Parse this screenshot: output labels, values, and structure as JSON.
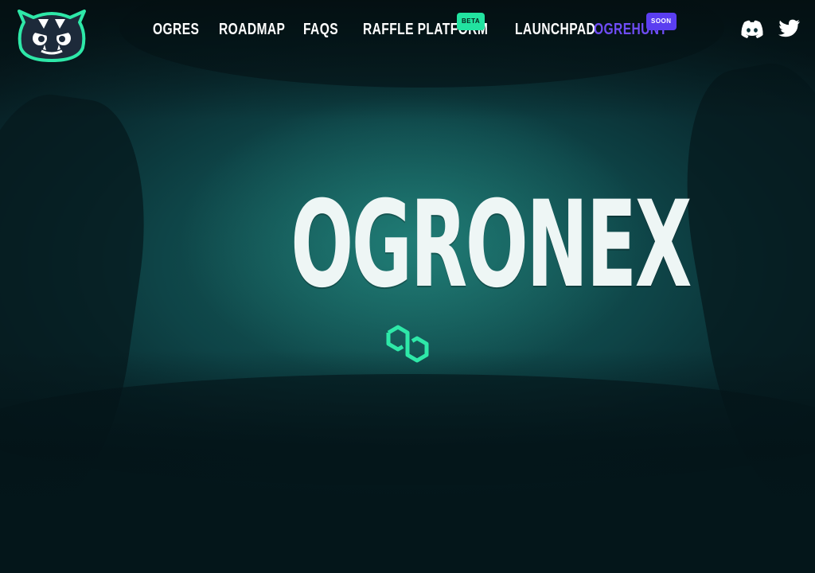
{
  "brand": {
    "logo_name": "ogre-face-logo"
  },
  "nav": {
    "items": [
      {
        "label": "OGRES"
      },
      {
        "label": "ROADMAP"
      },
      {
        "label": "FAQS"
      },
      {
        "label": "RAFFLE PLATFORM",
        "badge": "BETA"
      },
      {
        "label": "LAUNCHPAD"
      },
      {
        "label": "OGREHUNT",
        "badge": "SOON"
      }
    ]
  },
  "social": {
    "discord": "discord-icon",
    "twitter": "twitter-icon"
  },
  "hero": {
    "title": "OGRONEX",
    "chain_icon": "polygon-icon"
  },
  "colors": {
    "accent_green": "#22e3a0",
    "accent_purple": "#5b3ef0",
    "nav_text": "#ffffff",
    "ogrehunt_text": "#6f4df5",
    "background": "#0e4447"
  }
}
